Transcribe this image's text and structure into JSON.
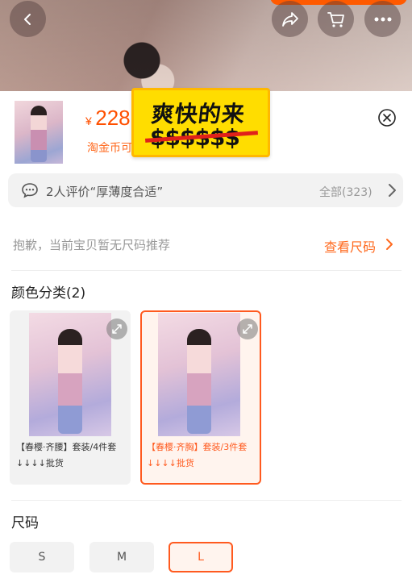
{
  "product": {
    "price_currency": "¥",
    "price_value": "228",
    "coin_text": "淘金币可"
  },
  "promo_sticker": {
    "line1": "爽快的来",
    "line2": "$$$$$$"
  },
  "review": {
    "text": "2人评价“厚薄度合适”",
    "all_label": "全部(323)"
  },
  "size_notice": {
    "text": "抱歉，当前宝贝暂无尺码推荐",
    "link_label": "查看尺码"
  },
  "color_section": {
    "title": "颜色分类(2)",
    "options": [
      {
        "caption": "【春樱·齐腰】套装/4件套↓↓↓↓批货",
        "selected": false
      },
      {
        "caption": "【春樱·齐胸】套装/3件套↓↓↓↓批货",
        "selected": true
      }
    ]
  },
  "size_section": {
    "title": "尺码",
    "options": [
      {
        "label": "S",
        "selected": false
      },
      {
        "label": "M",
        "selected": false
      },
      {
        "label": "L",
        "selected": true
      }
    ]
  },
  "colors": {
    "accent": "#ff5a1f",
    "price": "#ff5000",
    "sticker": "#ffdd00"
  },
  "icons": [
    "back-icon",
    "share-icon",
    "cart-icon",
    "more-icon",
    "close-icon",
    "chat-icon",
    "chevron-right-icon",
    "expand-icon"
  ]
}
